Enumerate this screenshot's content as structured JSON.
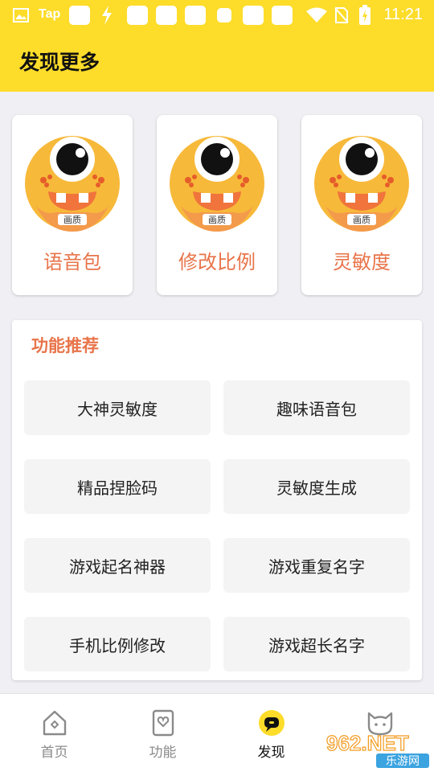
{
  "status_bar": {
    "tap_label": "Tap",
    "time": "11:21"
  },
  "header": {
    "title": "发现更多"
  },
  "top_cards": [
    {
      "label": "语音包",
      "avatar_text": "画质"
    },
    {
      "label": "修改比例",
      "avatar_text": "画质"
    },
    {
      "label": "灵敏度",
      "avatar_text": "画质"
    }
  ],
  "functions": {
    "title": "功能推荐",
    "items": [
      {
        "label": "大神灵敏度"
      },
      {
        "label": "趣味语音包"
      },
      {
        "label": "精品捏脸码"
      },
      {
        "label": "灵敏度生成"
      },
      {
        "label": "游戏起名神器"
      },
      {
        "label": "游戏重复名字"
      },
      {
        "label": "手机比例修改"
      },
      {
        "label": "游戏超长名字"
      }
    ]
  },
  "bottom_nav": {
    "items": [
      {
        "label": "首页",
        "icon": "home-icon"
      },
      {
        "label": "功能",
        "icon": "function-icon"
      },
      {
        "label": "发现",
        "icon": "discover-icon",
        "active": true
      },
      {
        "label": "",
        "icon": "cat-icon"
      }
    ]
  },
  "watermark": {
    "top_text": "962.NET",
    "bottom_text": "乐游网"
  },
  "colors": {
    "brand_yellow": "#fddc2a",
    "accent_orange": "#e8744a",
    "background": "#efeff4"
  }
}
